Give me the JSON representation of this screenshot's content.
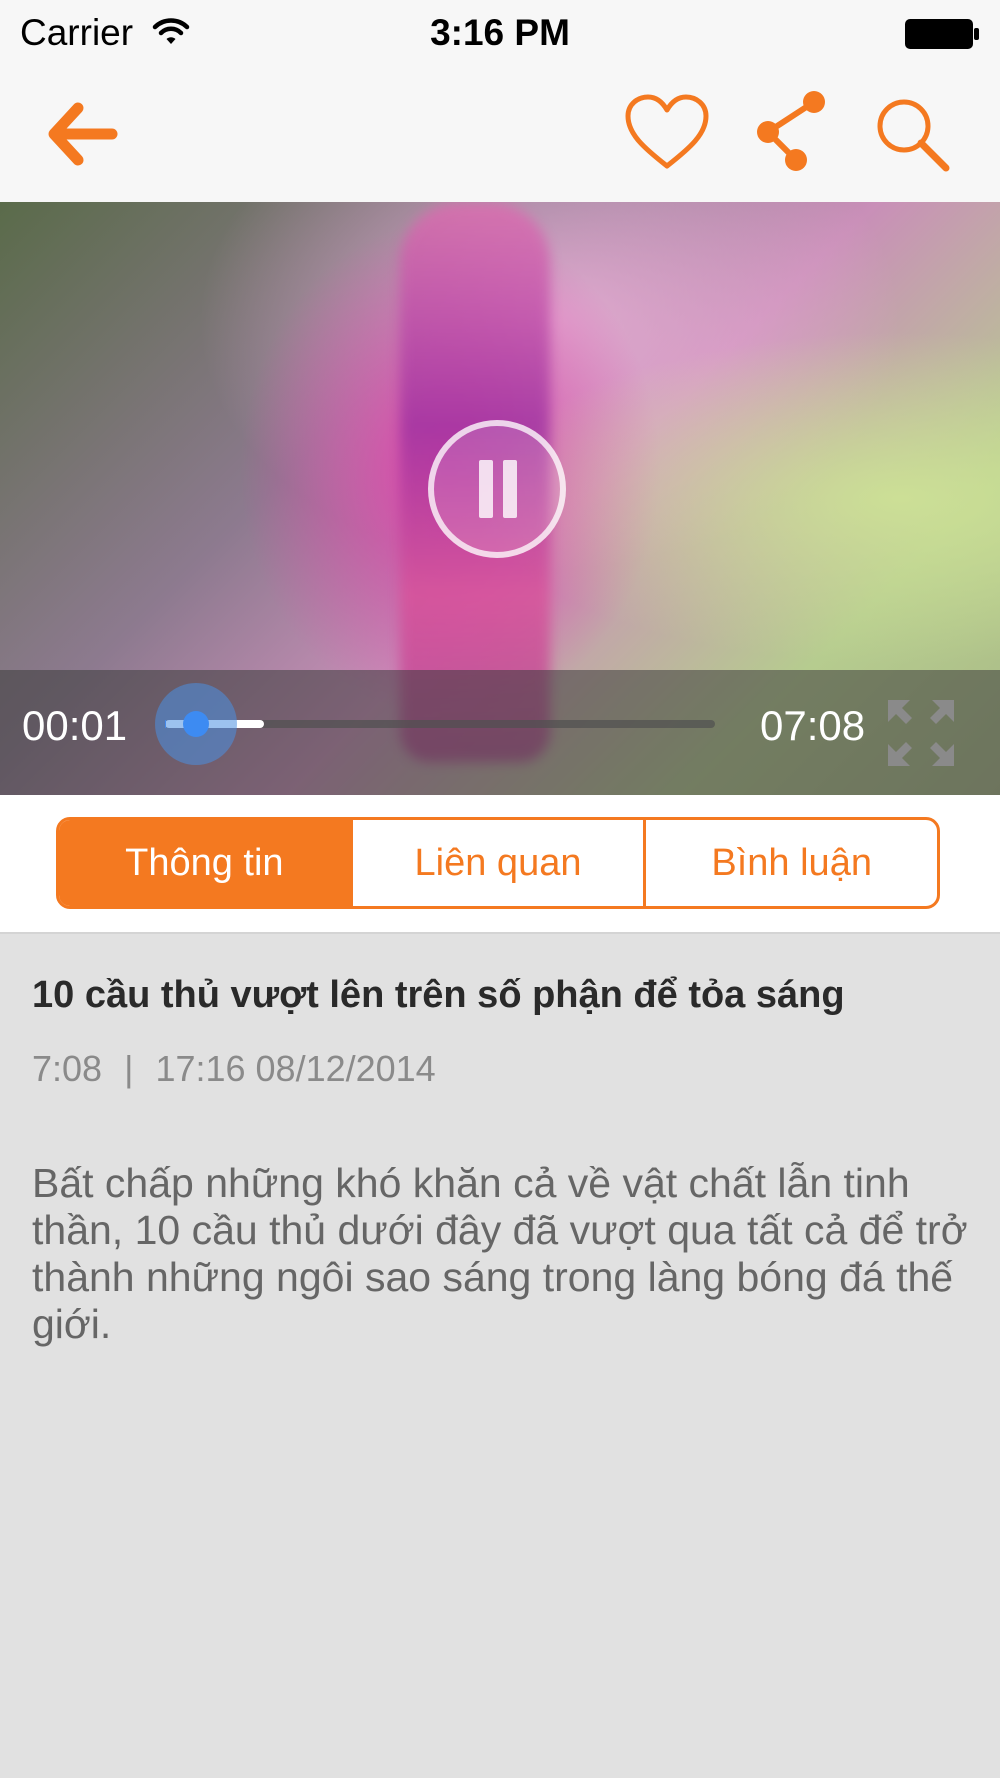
{
  "status_bar": {
    "carrier": "Carrier",
    "time": "3:16 PM"
  },
  "nav": {
    "accent_color": "#f47920",
    "icons": [
      "back-arrow-icon",
      "heart-icon",
      "share-icon",
      "search-icon"
    ]
  },
  "video": {
    "elapsed": "00:01",
    "duration": "07:08",
    "progress_fraction": 0.002,
    "buffered_fraction": 0.18,
    "state": "playing"
  },
  "tabs": [
    {
      "label": "Thông tin",
      "active": true
    },
    {
      "label": "Liên quan",
      "active": false
    },
    {
      "label": "Bình luận",
      "active": false
    }
  ],
  "article": {
    "title": "10 cầu thủ vượt lên trên số phận để tỏa sáng",
    "length": "7:08",
    "separator": "|",
    "published": "17:16 08/12/2014",
    "description": "Bất chấp những khó khăn cả về vật chất lẫn tinh thần, 10 cầu thủ dưới đây đã vượt qua tất cả để trở thành những ngôi sao sáng trong làng bóng đá thế giới."
  }
}
